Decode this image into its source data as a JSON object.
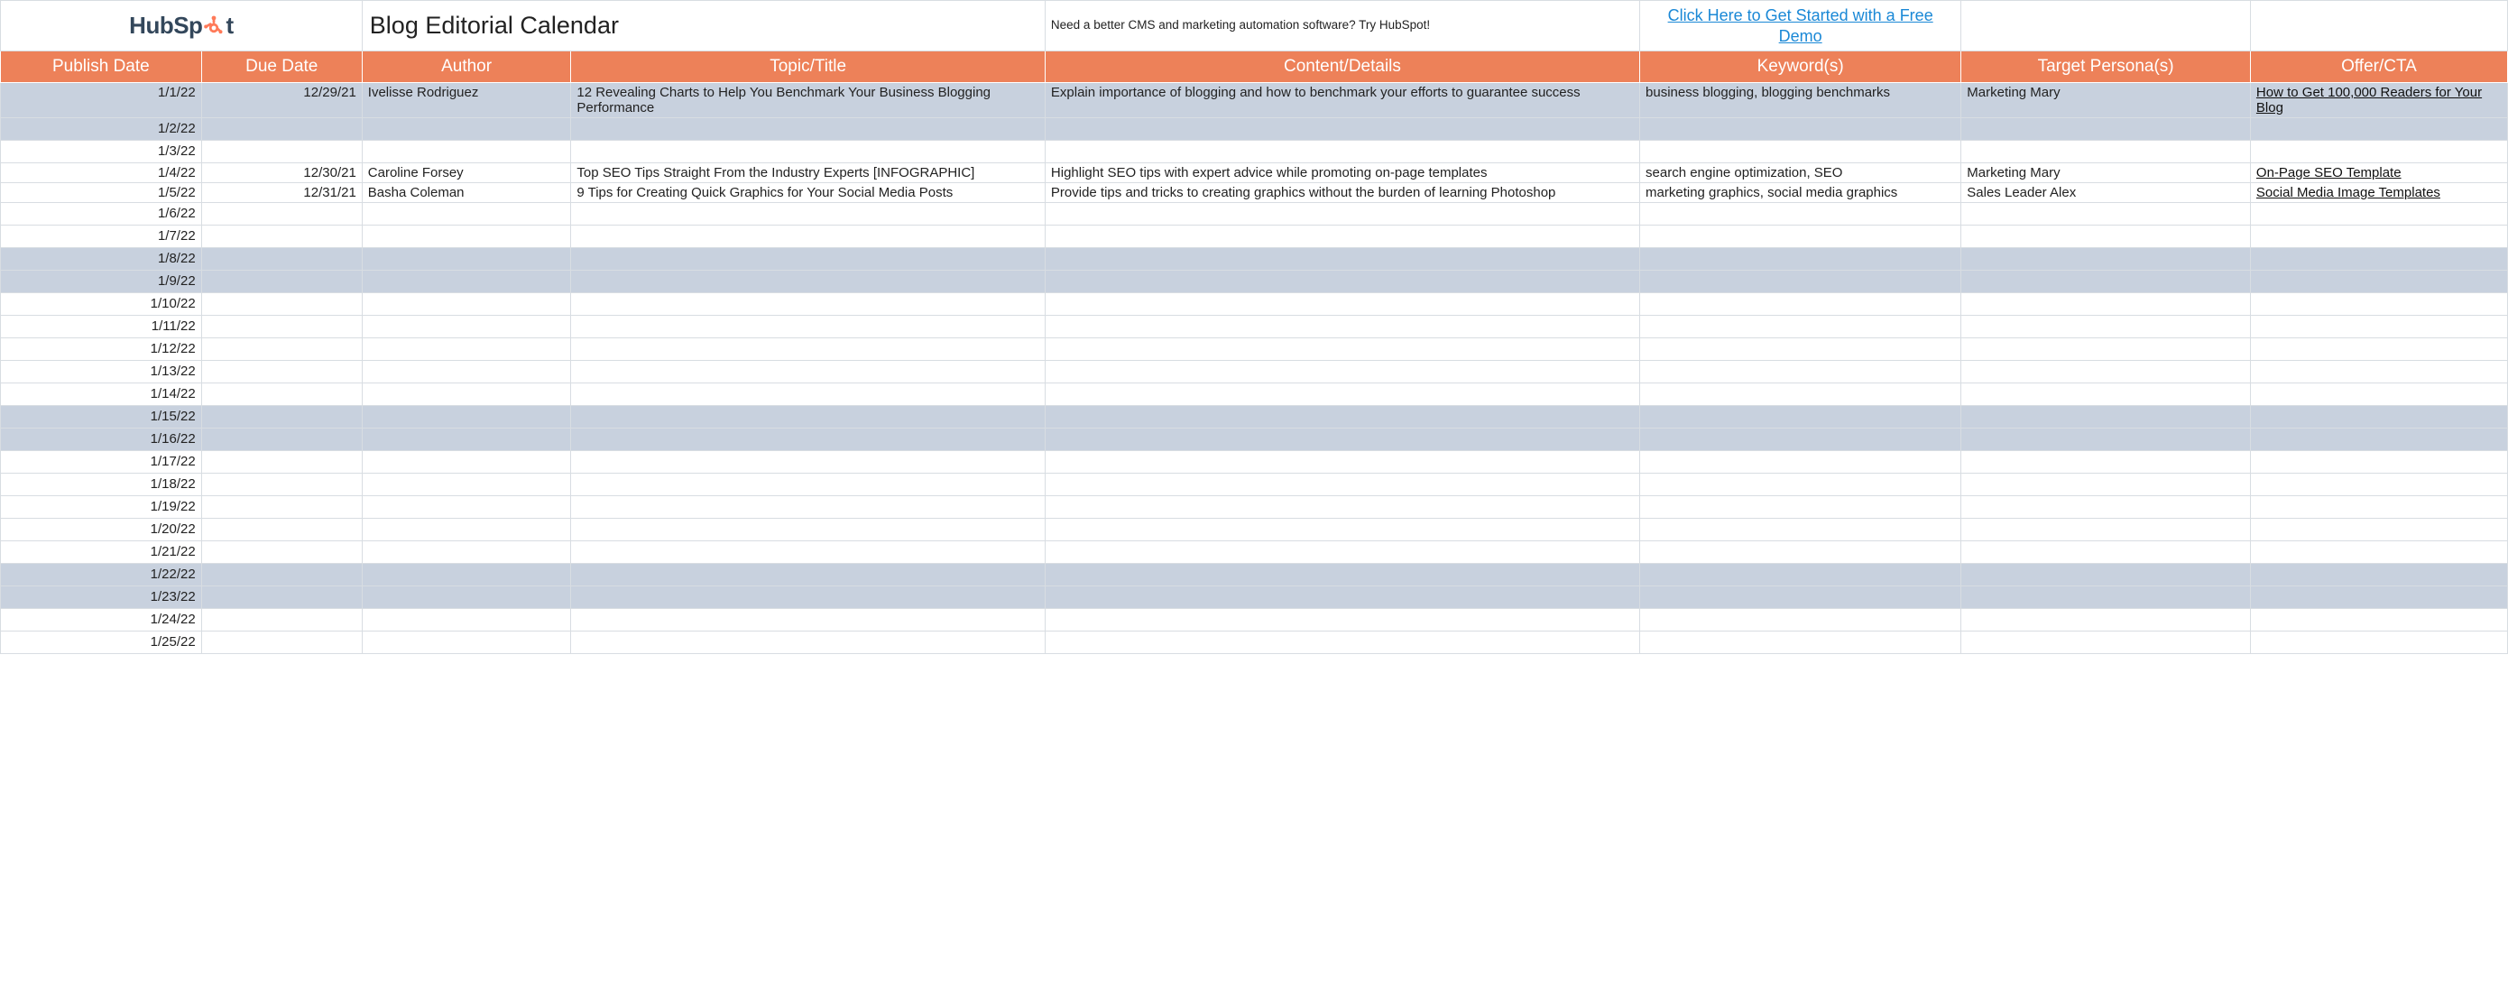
{
  "header": {
    "logo_text_a": "HubSp",
    "logo_text_b": "t",
    "title": "Blog Editorial Calendar",
    "promo_text": "Need a better CMS and marketing automation software? Try HubSpot!",
    "demo_link": "Click Here to Get Started with a Free Demo"
  },
  "columns": {
    "publish": "Publish Date",
    "due": "Due Date",
    "author": "Author",
    "topic": "Topic/Title",
    "content": "Content/Details",
    "keywords": "Keyword(s)",
    "persona": "Target Persona(s)",
    "cta": "Offer/CTA"
  },
  "rows": [
    {
      "publish": "1/1/22",
      "due": "12/29/21",
      "author": "Ivelisse Rodriguez",
      "topic": "12 Revealing Charts to Help You Benchmark Your Business Blogging Performance",
      "content": "Explain importance of blogging and how to benchmark your efforts to guarantee success",
      "keywords": "business blogging, blogging benchmarks",
      "persona": "Marketing Mary",
      "cta": "How to Get 100,000 Readers for Your Blog",
      "shaded": true,
      "tall": true
    },
    {
      "publish": "1/2/22",
      "shaded": true
    },
    {
      "publish": "1/3/22"
    },
    {
      "publish": "1/4/22",
      "due": "12/30/21",
      "author": "Caroline Forsey",
      "topic": "Top SEO Tips Straight From the Industry Experts [INFOGRAPHIC]",
      "content": "Highlight SEO tips with expert advice while promoting on-page templates",
      "keywords": "search engine optimization, SEO",
      "persona": "Marketing Mary",
      "cta": "On-Page SEO Template",
      "tall": true
    },
    {
      "publish": "1/5/22",
      "due": "12/31/21",
      "author": "Basha Coleman",
      "topic": "9 Tips for Creating Quick Graphics for Your Social Media Posts",
      "content": "Provide tips and tricks to creating graphics without the burden of learning Photoshop",
      "keywords": "marketing graphics, social media graphics",
      "persona": "Sales Leader Alex",
      "cta": "Social Media Image Templates",
      "tall": true
    },
    {
      "publish": "1/6/22"
    },
    {
      "publish": "1/7/22"
    },
    {
      "publish": "1/8/22",
      "shaded": true
    },
    {
      "publish": "1/9/22",
      "shaded": true
    },
    {
      "publish": "1/10/22"
    },
    {
      "publish": "1/11/22"
    },
    {
      "publish": "1/12/22"
    },
    {
      "publish": "1/13/22"
    },
    {
      "publish": "1/14/22"
    },
    {
      "publish": "1/15/22",
      "shaded": true
    },
    {
      "publish": "1/16/22",
      "shaded": true
    },
    {
      "publish": "1/17/22"
    },
    {
      "publish": "1/18/22"
    },
    {
      "publish": "1/19/22"
    },
    {
      "publish": "1/20/22"
    },
    {
      "publish": "1/21/22"
    },
    {
      "publish": "1/22/22",
      "shaded": true
    },
    {
      "publish": "1/23/22",
      "shaded": true
    },
    {
      "publish": "1/24/22"
    },
    {
      "publish": "1/25/22"
    }
  ]
}
